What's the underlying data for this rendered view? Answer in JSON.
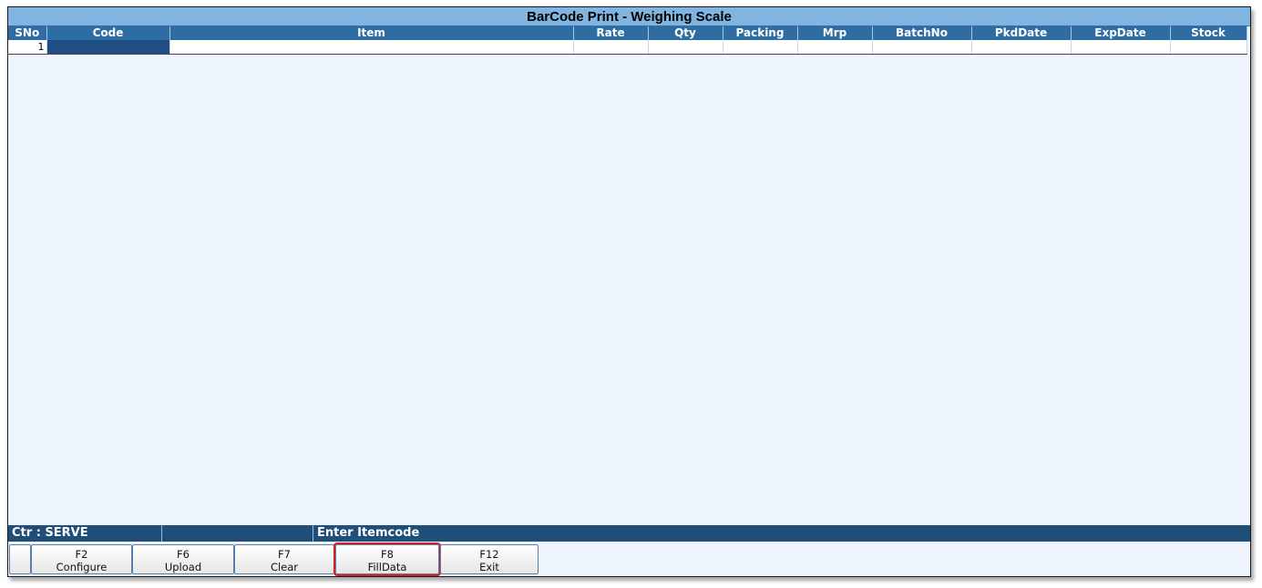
{
  "window": {
    "title": "BarCode Print - Weighing Scale"
  },
  "grid": {
    "columns": [
      "SNo",
      "Code",
      "Item",
      "Rate",
      "Qty",
      "Packing",
      "Mrp",
      "BatchNo",
      "PkdDate",
      "ExpDate",
      "Stock"
    ],
    "rows": [
      {
        "sno": "1",
        "code": "",
        "item": "",
        "rate": "",
        "qty": "",
        "packing": "",
        "mrp": "",
        "batchno": "",
        "pkddate": "",
        "expdate": "",
        "stock": ""
      }
    ]
  },
  "status": {
    "counter": "Ctr : SERVE",
    "middle": "",
    "message": "Enter Itemcode"
  },
  "fkeys": [
    {
      "key": "",
      "label": ""
    },
    {
      "key": "F2",
      "label": "Configure"
    },
    {
      "key": "F6",
      "label": "Upload"
    },
    {
      "key": "F7",
      "label": "Clear"
    },
    {
      "key": "F8",
      "label": "FillData"
    },
    {
      "key": "F12",
      "label": "Exit"
    }
  ],
  "colors": {
    "header": "#2e6da4",
    "title_bar": "#7fb5e0",
    "status_bar": "#1f4e79",
    "highlight": "#d0202a"
  }
}
